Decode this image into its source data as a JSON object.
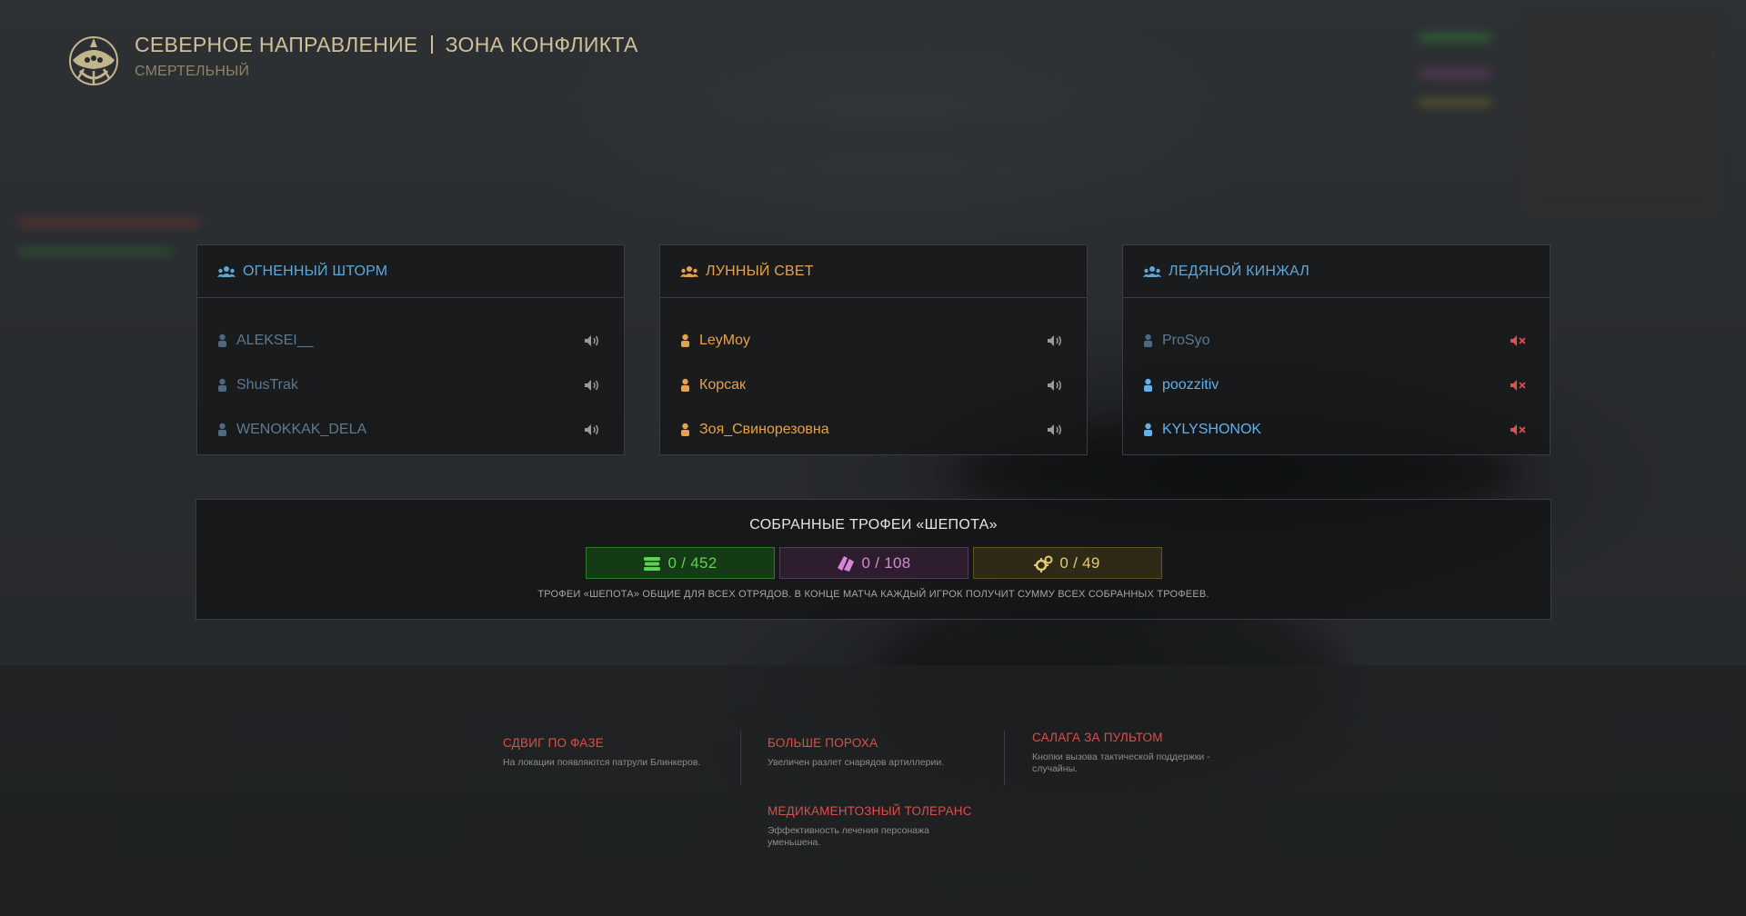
{
  "mission": {
    "title_part1": "СЕВЕРНОЕ НАПРАВЛЕНИЕ",
    "title_part2": "ЗОНА КОНФЛИКТА",
    "difficulty": "СМЕРТЕЛЬНЫЙ",
    "emblem_icon": "skull-crest-icon"
  },
  "squads": [
    {
      "name": "ОГНЕННЫЙ ШТОРМ",
      "name_color": "#5fa7d9",
      "icon": "group-icon",
      "players": [
        {
          "name": "ALEKSEI__",
          "color": "#5d7a92",
          "voice": "speaker-icon"
        },
        {
          "name": "ShusTrak",
          "color": "#5d7a92",
          "voice": "speaker-icon"
        },
        {
          "name": "WENOKKAK_DELA",
          "color": "#5d7a92",
          "voice": "speaker-icon"
        }
      ]
    },
    {
      "name": "ЛУННЫЙ СВЕТ",
      "name_color": "#e6a24a",
      "icon": "group-icon",
      "players": [
        {
          "name": "LeyMoy",
          "color": "#e6a24a",
          "voice": "speaker-icon"
        },
        {
          "name": "Корсак",
          "color": "#e6a24a",
          "voice": "speaker-icon"
        },
        {
          "name": "Зоя_Свинорезовна",
          "color": "#e6a24a",
          "voice": "speaker-icon"
        }
      ]
    },
    {
      "name": "ЛЕДЯНОЙ КИНЖАЛ",
      "name_color": "#5fa7d9",
      "icon": "group-icon",
      "players": [
        {
          "name": "ProSyo",
          "color": "#5d7a92",
          "voice": "speaker-muted-icon"
        },
        {
          "name": "poozzitiv",
          "color": "#63b0ea",
          "voice": "speaker-muted-icon"
        },
        {
          "name": "KYLYSHONOK",
          "color": "#63b0ea",
          "voice": "speaker-muted-icon"
        }
      ]
    }
  ],
  "trophies": {
    "title": "СОБРАННЫЕ ТРОФЕИ «ШЕПОТА»",
    "counters": [
      {
        "value": "0 / 452",
        "icon": "stack-green-icon",
        "color": "#5fd152"
      },
      {
        "value": "0 / 108",
        "icon": "cards-purple-icon",
        "color": "#d886d6"
      },
      {
        "value": "0 / 49",
        "icon": "gears-gold-icon",
        "color": "#e4cb72"
      }
    ],
    "note": "ТРОФЕИ «ШЕПОТА» ОБЩИЕ ДЛЯ ВСЕХ ОТРЯДОВ. В КОНЦЕ МАТЧА КАЖДЫЙ ИГРОК ПОЛУЧИТ СУММУ ВСЕХ СОБРАННЫХ ТРОФЕЕВ."
  },
  "modifiers": [
    {
      "title": "СДВИГ ПО ФАЗЕ",
      "description": "На локации появляются патрули Блинкеров."
    },
    {
      "title": "БОЛЬШЕ ПОРОХА",
      "description": "Увеличен разлет снарядов артиллерии."
    },
    {
      "title": "САЛАГА ЗА ПУЛЬТОМ",
      "description": "Кнопки вызова тактической поддержки - случайны."
    },
    {
      "title": "МЕДИКАМЕНТОЗНЫЙ ТОЛЕРАНС",
      "description": "Эффективность лечения персонажа уменьшена."
    }
  ]
}
